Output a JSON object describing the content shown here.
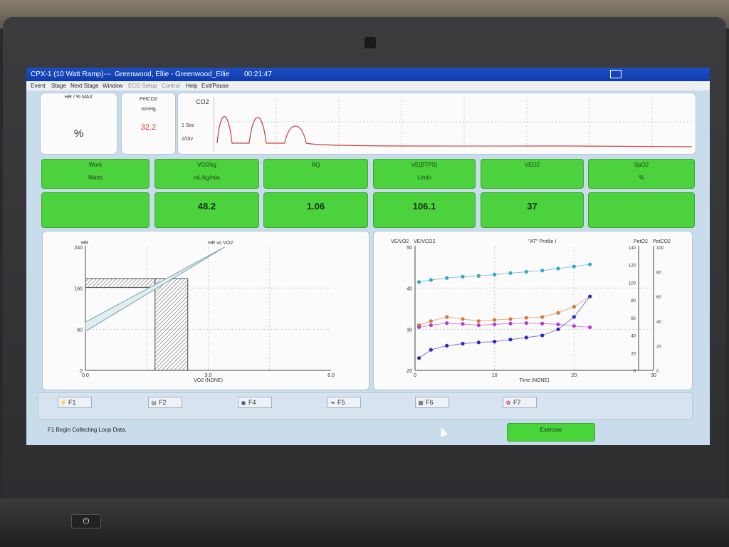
{
  "window": {
    "title_app": "CPX-1 (10 Watt Ramp)",
    "title_sep": "---",
    "title_patient": "Greenwood, Ellie - Greenwood_Ellie",
    "title_time": "00:21:47"
  },
  "menu": [
    "Event",
    "Stage",
    "Next Stage",
    "Window",
    "ECG Setup",
    "Control",
    "Help",
    "Exit/Pause"
  ],
  "menu_disabled": [
    "ECG Setup",
    "Control"
  ],
  "top_boxes": {
    "hr": {
      "label": "HR / % MAX",
      "unit": "%"
    },
    "petco2": {
      "label": "PetCO2",
      "unit": "mmHg",
      "value": "32.2",
      "value_color": "#e03030"
    },
    "co2": {
      "label": "CO2",
      "speed": "1 Sec",
      "div": "1/Div"
    }
  },
  "metrics": [
    {
      "label": "Work",
      "unit": "Watts",
      "value": ""
    },
    {
      "label": "VO2/kg",
      "unit": "mL/kg/min",
      "value": "48.2"
    },
    {
      "label": "RQ",
      "unit": "",
      "value": "1.06"
    },
    {
      "label": "VE(BTPS)",
      "unit": "L/min",
      "value": "106.1"
    },
    {
      "label": "VEO2",
      "unit": "",
      "value": "37"
    },
    {
      "label": "SpO2",
      "unit": "%",
      "value": ""
    }
  ],
  "chart_data": [
    {
      "type": "line",
      "title": "HR vs VO2",
      "ylabel": "HR",
      "xlabel": "VO2   (NONE)",
      "xlim": [
        0,
        6
      ],
      "ylim": [
        0,
        240
      ],
      "x_ticks": [
        "0.0",
        "3.0",
        "6.0"
      ],
      "y_ticks": [
        "0",
        "80",
        "160",
        "240"
      ],
      "target_band": {
        "x0": 0,
        "x1": 1.7,
        "y_low_at_x0": 76,
        "y_high_at_x0": 94,
        "slope_per_unit": 90
      },
      "target_box": {
        "hr": 170,
        "vo2": 1.7,
        "vo2_right": 2.5
      }
    },
    {
      "type": "scatter",
      "title": "\"AT\" Profile I",
      "xlabel": "Time   (NONE)",
      "left_axes": [
        "VE/VO2",
        "VE/VCO2"
      ],
      "right_axes": [
        "PetO2",
        "PetCO2"
      ],
      "xlim": [
        0,
        30
      ],
      "ylim_left": [
        20,
        50
      ],
      "ylim_right_pet_o2": [
        0,
        140
      ],
      "ylim_right_pet_co2": [
        0,
        100
      ],
      "x_ticks": [
        "0",
        "10",
        "20",
        "30"
      ],
      "y_ticks_left": [
        "20",
        "30",
        "40",
        "50"
      ],
      "y_ticks_right_o2": [
        "0",
        "20",
        "40",
        "60",
        "80",
        "100",
        "120",
        "140"
      ],
      "y_ticks_right_co2": [
        "0",
        "20",
        "40",
        "60",
        "80",
        "100"
      ],
      "series": [
        {
          "color": "#35a7c9",
          "values": [
            [
              0.5,
              41.5
            ],
            [
              2,
              42
            ],
            [
              4,
              42.5
            ],
            [
              6,
              42.8
            ],
            [
              8,
              43
            ],
            [
              10,
              43.3
            ],
            [
              12,
              43.7
            ],
            [
              14,
              44
            ],
            [
              16,
              44.3
            ],
            [
              18,
              44.8
            ],
            [
              20,
              45.3
            ],
            [
              22,
              45.8
            ]
          ]
        },
        {
          "color": "#d07a3a",
          "values": [
            [
              0.5,
              31
            ],
            [
              2,
              32
            ],
            [
              4,
              33
            ],
            [
              6,
              32.5
            ],
            [
              8,
              32
            ],
            [
              10,
              32.3
            ],
            [
              12,
              32.5
            ],
            [
              14,
              32.8
            ],
            [
              16,
              33
            ],
            [
              18,
              34
            ],
            [
              20,
              35.5
            ],
            [
              22,
              38
            ]
          ]
        },
        {
          "color": "#b53cc8",
          "values": [
            [
              0.5,
              30.5
            ],
            [
              2,
              31
            ],
            [
              4,
              31.5
            ],
            [
              6,
              31.3
            ],
            [
              8,
              31
            ],
            [
              10,
              31.2
            ],
            [
              12,
              31.4
            ],
            [
              14,
              31.5
            ],
            [
              16,
              31.4
            ],
            [
              18,
              31.2
            ],
            [
              20,
              30.8
            ],
            [
              22,
              30.5
            ]
          ]
        },
        {
          "color": "#2a2ac0",
          "values": [
            [
              0.5,
              23
            ],
            [
              2,
              25
            ],
            [
              4,
              26
            ],
            [
              6,
              26.5
            ],
            [
              8,
              26.8
            ],
            [
              10,
              27
            ],
            [
              12,
              27.5
            ],
            [
              14,
              28
            ],
            [
              16,
              28.5
            ],
            [
              18,
              30
            ],
            [
              20,
              33
            ],
            [
              22,
              38
            ]
          ]
        }
      ]
    }
  ],
  "fkeys": [
    {
      "label": "F1",
      "icon": "loop-icon"
    },
    {
      "label": "F2",
      "icon": "keyboard-icon"
    },
    {
      "label": "F4",
      "icon": "bike-icon"
    },
    {
      "label": "F5",
      "icon": "chart-icon"
    },
    {
      "label": "F6",
      "icon": "table-icon"
    },
    {
      "label": "F7",
      "icon": "flower-icon"
    }
  ],
  "status": "F1 Begin Collecting Loop Data.",
  "mode_button": "Exercise",
  "laptop": {
    "power_icon": "power-icon"
  }
}
